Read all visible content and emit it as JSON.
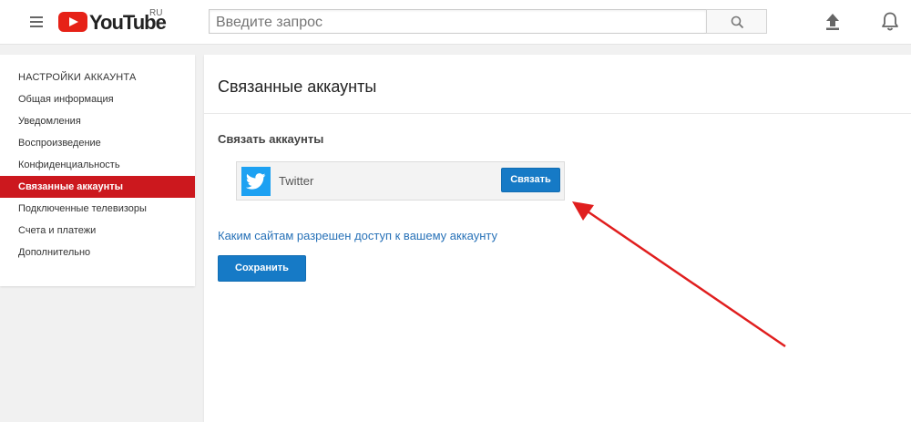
{
  "header": {
    "logo_text": "YouTube",
    "logo_region": "RU",
    "search_placeholder": "Введите запрос",
    "icons": {
      "menu": "menu-icon",
      "search": "search-icon",
      "upload": "upload-icon",
      "notifications": "bell-icon"
    }
  },
  "sidebar": {
    "header": "НАСТРОЙКИ АККАУНТА",
    "items": [
      {
        "label": "Общая информация",
        "active": false
      },
      {
        "label": "Уведомления",
        "active": false
      },
      {
        "label": "Воспроизведение",
        "active": false
      },
      {
        "label": "Конфиденциальность",
        "active": false
      },
      {
        "label": "Связанные аккаунты",
        "active": true
      },
      {
        "label": "Подключенные телевизоры",
        "active": false
      },
      {
        "label": "Счета и платежи",
        "active": false
      },
      {
        "label": "Дополнительно",
        "active": false
      }
    ]
  },
  "main": {
    "title": "Связанные аккаунты",
    "section_title": "Связать аккаунты",
    "account": {
      "service_name": "Twitter",
      "icon": "twitter-icon",
      "connect_label": "Связать"
    },
    "access_link": "Каким сайтам разрешен доступ к вашему аккаунту",
    "save_label": "Сохранить"
  },
  "colors": {
    "brand_red": "#e62117",
    "active_item": "#cc181e",
    "primary_button": "#167ac6",
    "link": "#2872b8",
    "twitter": "#1da1f2",
    "annotation_arrow": "#e01e1e"
  }
}
